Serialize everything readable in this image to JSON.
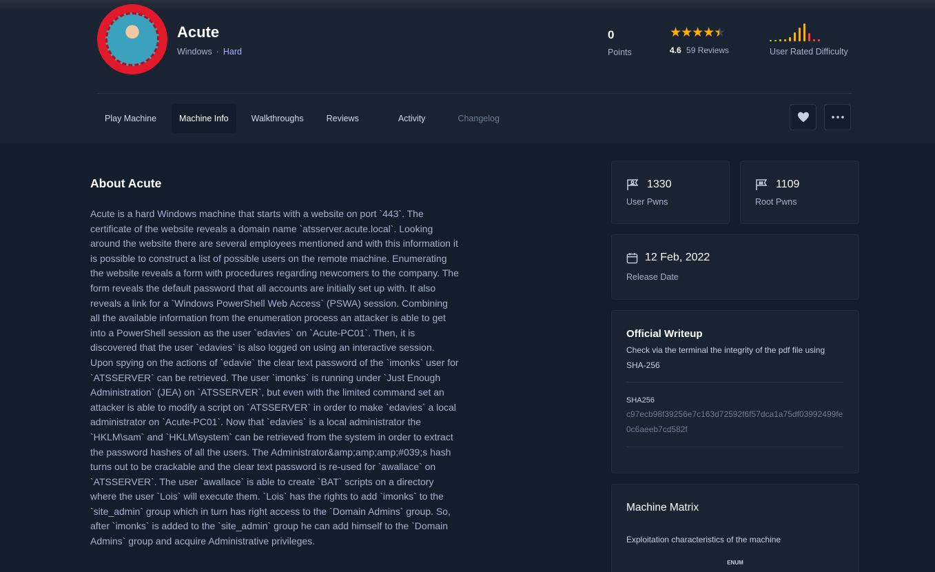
{
  "machine": {
    "name": "Acute",
    "os": "Windows",
    "separator": "·",
    "difficulty": "Hard"
  },
  "stats": {
    "points_value": "0",
    "points_label": "Points",
    "rating_value": "4.6",
    "reviews_label": "59 Reviews",
    "rating_fraction": 0.92,
    "user_rated_difficulty_label": "User Rated Difficulty",
    "difficulty_bar_colors": [
      "#9fef00",
      "#9fef00",
      "#ffaf00",
      "#ffaf00",
      "#ffaf00",
      "#ffaf00",
      "#ffaf00",
      "#ffaf00",
      "#ff3e3e",
      "#ff3e3e",
      "#ff3e3e"
    ]
  },
  "tabs": [
    {
      "label": "Play Machine"
    },
    {
      "label": "Machine Info"
    },
    {
      "label": "Walkthroughs"
    },
    {
      "label": "Reviews"
    },
    {
      "label": "Activity"
    },
    {
      "label": "Changelog"
    }
  ],
  "about": {
    "title": "About Acute",
    "body": "Acute is a hard Windows machine that starts with a website on port `443`. The certificate of the website reveals a domain name `atsserver.acute.local`. Looking around the website there are several employees mentioned and with this information it is possible to construct a list of possible users on the remote machine. Enumerating the website reveals a form with procedures regarding newcomers to the company. The form reveals the default password that all accounts are initially set up with. It also reveals a link for a `Windows PowerShell Web Access` (PSWA) session. Combining all the available information from the enumeration process an attacker is able to get into a PowerShell session as the user `edavies` on `Acute-PC01`. Then, it is discovered that the user `edavies` is also logged on using an interactive session. Upon spying on the actions of `edavie` the clear text password of the `imonks` user for `ATSSERVER` can be retrieved. The user `imonks` is running under `Just Enough Administration` (JEA) on `ATSSERVER`, but even with the limited command set an attacker is able to modify a script on `ATSSERVER` in order to make `edavies` a local administrator on `Acute-PC01`. Now that `edavies` is a local administrator the `HKLM\\sam` and `HKLM\\system` can be retrieved from the system in order to extract the password hashes of all the users. The Administrator&amp;amp;amp;#039;s hash turns out to be crackable and the clear text password is re-used for `awallace` on `ATSSERVER`. The user `awallace` is able to create `BAT` scripts on a directory where the user `Lois` will execute them. `Lois` has the rights to add `imonks` to the `site_admin` group which in turn has right access to the `Domain Admins` group. So, after `imonks` is added to the `site_admin` group he can add himself to the `Domain Admins` group and acquire Administrative privileges."
  },
  "cards": {
    "user_pwns_value": "1330",
    "user_pwns_label": "User Pwns",
    "root_pwns_value": "1109",
    "root_pwns_label": "Root Pwns",
    "release_date_value": "12 Feb, 2022",
    "release_date_label": "Release Date"
  },
  "writeup": {
    "title": "Official Writeup",
    "description": "Check via the terminal the integrity of the pdf file using SHA-256",
    "sha_label": "SHA256",
    "sha_value": "c97ecb98f39256e7c163d72592f6f57dca1a75df03992499fe0c6aeeb7cd582f"
  },
  "matrix": {
    "title": "Machine Matrix",
    "description": "Exploitation characteristics of the machine",
    "axis_label": "ENUM"
  },
  "icons": {
    "heart": "heart-icon",
    "more": "more-icon",
    "user_flag": "user-flag-icon",
    "root_flag": "root-flag-icon",
    "calendar": "calendar-icon",
    "star": "star-icon"
  }
}
